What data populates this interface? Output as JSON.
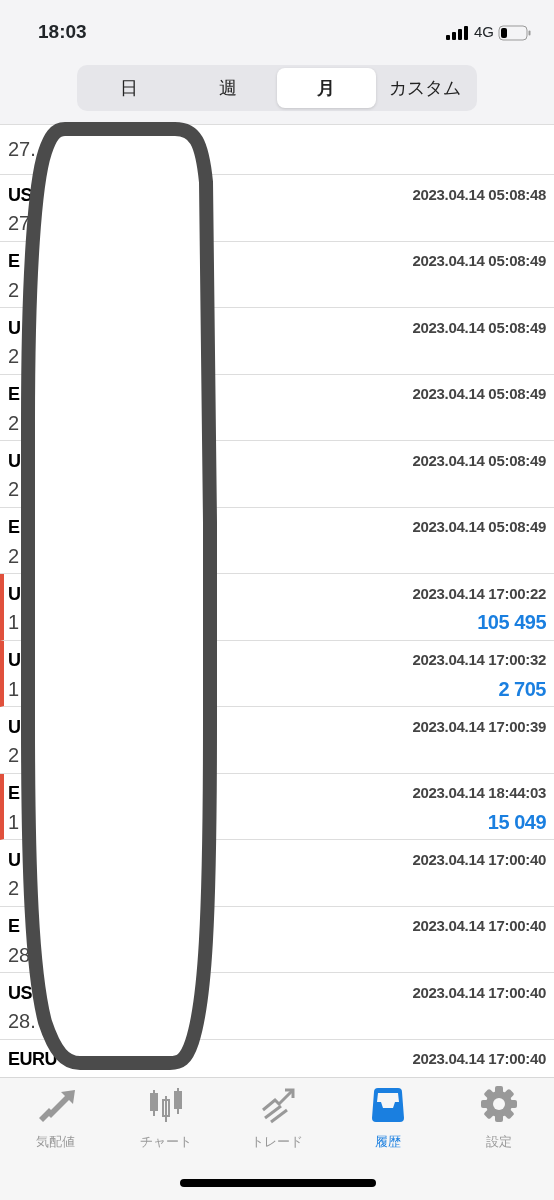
{
  "status_bar": {
    "time": "18:03",
    "network": "4G"
  },
  "period_tabs": [
    {
      "label": "日",
      "selected": false
    },
    {
      "label": "週",
      "selected": false
    },
    {
      "label": "月",
      "selected": true
    },
    {
      "label": "カスタム",
      "selected": false
    }
  ],
  "deals": [
    {
      "value": "27.",
      "flagged": false
    },
    {
      "symbol": "US",
      "value": "27",
      "time": "2023.04.14 05:08:48",
      "flagged": false
    },
    {
      "symbol": "E",
      "value": "2",
      "time": "2023.04.14 05:08:49",
      "flagged": false
    },
    {
      "symbol": "U",
      "value": "2",
      "time": "2023.04.14 05:08:49",
      "flagged": false
    },
    {
      "symbol": "E",
      "value": "2",
      "time": "2023.04.14 05:08:49",
      "flagged": false
    },
    {
      "symbol": "U",
      "value": "2",
      "time": "2023.04.14 05:08:49",
      "flagged": false
    },
    {
      "symbol": "E",
      "value": "2",
      "time": "2023.04.14 05:08:49",
      "flagged": false
    },
    {
      "symbol": "U",
      "value": "1",
      "time": "2023.04.14 17:00:22",
      "profit": "105 495",
      "flagged": true
    },
    {
      "symbol": "U",
      "value": "1",
      "time": "2023.04.14 17:00:32",
      "profit": "2 705",
      "flagged": true
    },
    {
      "symbol": "U",
      "value": "2",
      "time": "2023.04.14 17:00:39",
      "flagged": false
    },
    {
      "symbol": "E",
      "value": "1",
      "time": "2023.04.14 18:44:03",
      "profit": "15 049",
      "flagged": true
    },
    {
      "symbol": "U",
      "value": "2",
      "time": "2023.04.14 17:00:40",
      "flagged": false
    },
    {
      "symbol": "E",
      "value": "28",
      "time": "2023.04.14 17:00:40",
      "flagged": false
    },
    {
      "symbol": "US",
      "value": "28.",
      "time": "2023.04.14 17:00:40",
      "flagged": false
    },
    {
      "symbol": "EURU",
      "time": "2023.04.14 17:00:40",
      "flagged": false
    }
  ],
  "tab_bar": [
    {
      "kind": "quotes",
      "label": "気配値",
      "selected": false
    },
    {
      "kind": "chart",
      "label": "チャート",
      "selected": false
    },
    {
      "kind": "trade",
      "label": "トレード",
      "selected": false
    },
    {
      "kind": "history",
      "label": "履歴",
      "selected": true
    },
    {
      "kind": "settings",
      "label": "設定",
      "selected": false
    }
  ]
}
